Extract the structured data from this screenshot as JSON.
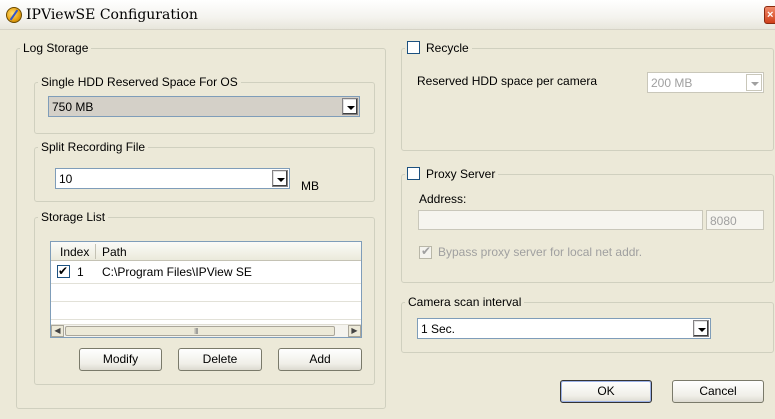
{
  "window": {
    "title": "IPViewSE Configuration",
    "close_glyph": "×"
  },
  "log_storage": {
    "legend": "Log Storage",
    "reserved": {
      "legend": "Single HDD Reserved Space For OS",
      "value": "750 MB"
    },
    "split": {
      "legend": "Split Recording File",
      "value": "10",
      "unit": "MB"
    },
    "storage_list": {
      "legend": "Storage List",
      "columns": [
        "Index",
        "Path"
      ],
      "rows": [
        {
          "index": "1",
          "path": "C:\\Program Files\\IPView SE",
          "checked": true
        }
      ],
      "scroll_grip": "III",
      "buttons": {
        "modify": "Modify",
        "delete": "Delete",
        "add": "Add"
      }
    }
  },
  "recycle": {
    "label": "Recycle",
    "checked": false,
    "space_label": "Reserved HDD space per camera",
    "space_value": "200 MB"
  },
  "proxy": {
    "label": "Proxy Server",
    "checked": false,
    "address_label": "Address:",
    "address_value": "",
    "port_value": "8080",
    "bypass_label": "Bypass proxy server for local net addr.",
    "bypass_checked": true
  },
  "camera_scan": {
    "legend": "Camera scan interval",
    "value": "1 Sec."
  },
  "dialog_buttons": {
    "ok": "OK",
    "cancel": "Cancel"
  },
  "icons": {
    "check": "✔",
    "scroll_left": "◀",
    "scroll_right": "▶"
  }
}
